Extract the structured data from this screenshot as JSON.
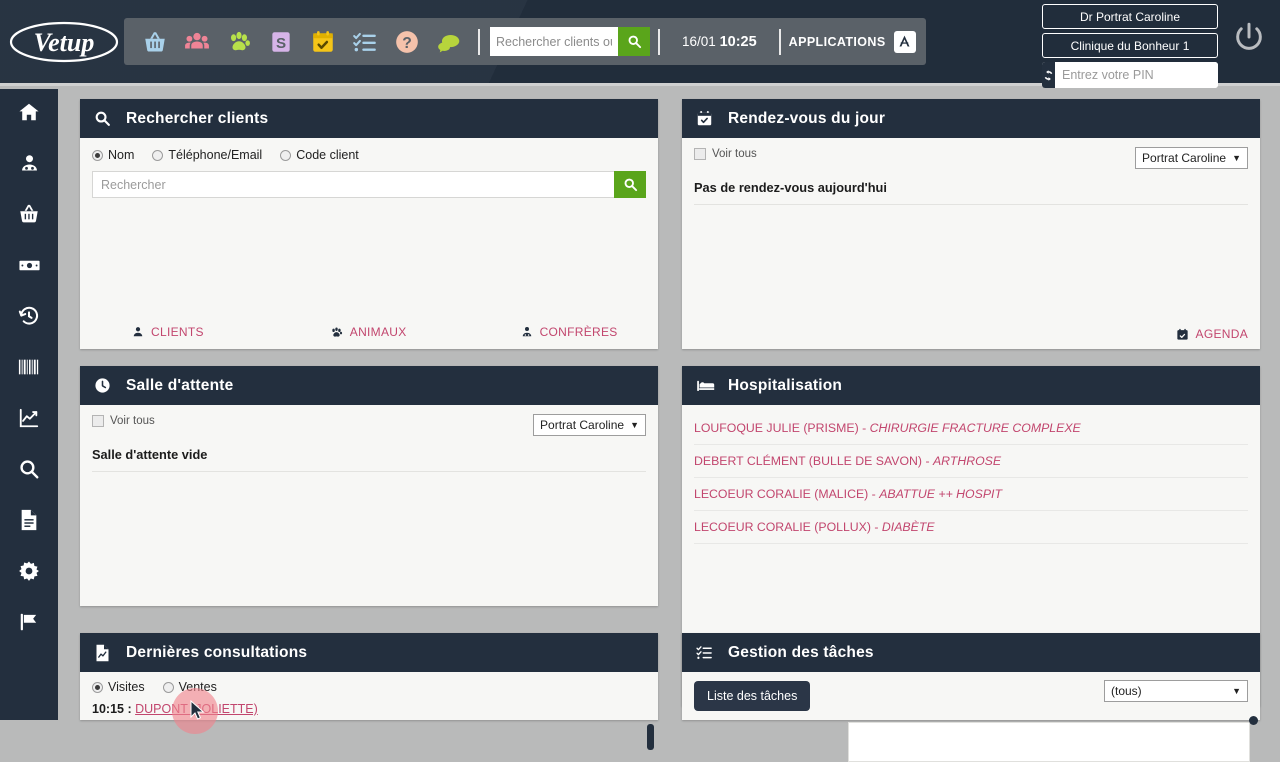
{
  "brand": {
    "name": "Vetup"
  },
  "header": {
    "toolbar_icons": [
      {
        "name": "basket-icon",
        "title": "Ventes"
      },
      {
        "name": "clients-group-icon",
        "title": "Clients"
      },
      {
        "name": "paw-icon",
        "title": "Animaux"
      },
      {
        "name": "dollar-icon",
        "title": "Caisse"
      },
      {
        "name": "calendar-icon",
        "title": "Agenda"
      },
      {
        "name": "checklist-icon",
        "title": "Taches"
      },
      {
        "name": "help-icon",
        "title": "Aide"
      },
      {
        "name": "chat-icon",
        "title": "Messages"
      }
    ],
    "search": {
      "placeholder": "Rechercher clients ou",
      "value": "",
      "button_icon": "search-icon"
    },
    "date": "16/01",
    "time": "10:25",
    "applications_label": "APPLICATIONS",
    "applications_icon": "applications-icon",
    "user_name": "Dr Portrat Caroline",
    "clinic_name": "Clinique du Bonheur 1",
    "pin_placeholder": "Entrez votre PIN",
    "pin_value": "",
    "pin_refresh_icon": "refresh-icon",
    "power_icon": "power-icon"
  },
  "sidebar": {
    "items": [
      {
        "icon": "home-icon",
        "label": "Accueil"
      },
      {
        "icon": "client-icon",
        "label": "Clients"
      },
      {
        "icon": "basket-icon",
        "label": "Ventes"
      },
      {
        "icon": "money-icon",
        "label": "Caisse"
      },
      {
        "icon": "history-icon",
        "label": "Historique"
      },
      {
        "icon": "barcode-icon",
        "label": "Stock"
      },
      {
        "icon": "chart-icon",
        "label": "Statistiques"
      },
      {
        "icon": "search-icon",
        "label": "Recherche"
      },
      {
        "icon": "document-icon",
        "label": "Documents"
      },
      {
        "icon": "gear-icon",
        "label": "Parametres"
      },
      {
        "icon": "flag-icon",
        "label": "Signalements"
      }
    ]
  },
  "panels": {
    "search_clients": {
      "icon": "search-icon",
      "title": "Rechercher clients",
      "radios": [
        {
          "label": "Nom",
          "selected": true
        },
        {
          "label": "Téléphone/Email",
          "selected": false
        },
        {
          "label": "Code client",
          "selected": false
        }
      ],
      "input_placeholder": "Rechercher",
      "input_value": "",
      "search_button_icon": "search-icon",
      "footer_links": [
        {
          "icon": "client-icon",
          "label": "CLIENTS"
        },
        {
          "icon": "paw-icon",
          "label": "ANIMAUX"
        },
        {
          "icon": "confrere-icon",
          "label": "CONFRÈRES"
        }
      ]
    },
    "appointments": {
      "icon": "calendar-check-icon",
      "title": "Rendez-vous du jour",
      "view_all_label": "Voir tous",
      "view_all_checked": false,
      "vet_filter": "Portrat Caroline",
      "empty_message": "Pas de rendez-vous aujourd'hui",
      "footer_link": {
        "icon": "calendar-check-icon",
        "label": "AGENDA"
      }
    },
    "waiting_room": {
      "icon": "clock-icon",
      "title": "Salle d'attente",
      "view_all_label": "Voir tous",
      "view_all_checked": false,
      "vet_filter": "Portrat Caroline",
      "empty_message": "Salle d'attente vide"
    },
    "hospitalisation": {
      "icon": "bed-icon",
      "title": "Hospitalisation",
      "items": [
        {
          "owner": "LOUFOQUE JULIE (PRISME)",
          "reason": "CHIRURGIE FRACTURE COMPLEXE"
        },
        {
          "owner": "DEBERT CLÉMENT (BULLE DE SAVON)",
          "reason": "ARTHROSE"
        },
        {
          "owner": "LECOEUR CORALIE (MALICE)",
          "reason": "ABATTUE ++ HOSPIT"
        },
        {
          "owner": "LECOEUR CORALIE (POLLUX)",
          "reason": "DIABÈTE"
        }
      ]
    },
    "consultations": {
      "icon": "document-chart-icon",
      "title": "Dernières consultations",
      "radios": [
        {
          "label": "Visites",
          "selected": true
        },
        {
          "label": "Ventes",
          "selected": false
        }
      ],
      "rows": [
        {
          "time": "10:15 :",
          "client": "DUPONT (JOLIETTE)"
        }
      ]
    },
    "tasks": {
      "icon": "checklist-icon",
      "title": "Gestion des tâches",
      "list_button_label": "Liste des tâches",
      "filter": "(tous)"
    }
  }
}
